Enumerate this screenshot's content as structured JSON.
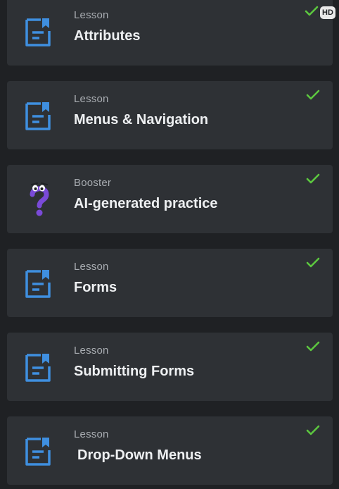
{
  "items": [
    {
      "type": "Lesson",
      "title": "Attributes",
      "icon": "lesson-icon",
      "completed": true
    },
    {
      "type": "Lesson",
      "title": "Menus & Navigation",
      "icon": "lesson-icon",
      "completed": true
    },
    {
      "type": "Booster",
      "title": "AI-generated practice",
      "icon": "booster-question-icon",
      "completed": true
    },
    {
      "type": "Lesson",
      "title": "Forms",
      "icon": "lesson-icon",
      "completed": true
    },
    {
      "type": "Lesson",
      "title": "Submitting Forms",
      "icon": "lesson-icon",
      "completed": true
    },
    {
      "type": "Lesson",
      "title": "Drop-Down Menus",
      "icon": "lesson-icon",
      "completed": true
    }
  ],
  "badge": {
    "label": "HD"
  },
  "colors": {
    "background": "#1f2124",
    "card": "#2e3135",
    "lesson_icon": "#3f8fe0",
    "check": "#5cc73f",
    "booster": "#7a4ad8"
  }
}
